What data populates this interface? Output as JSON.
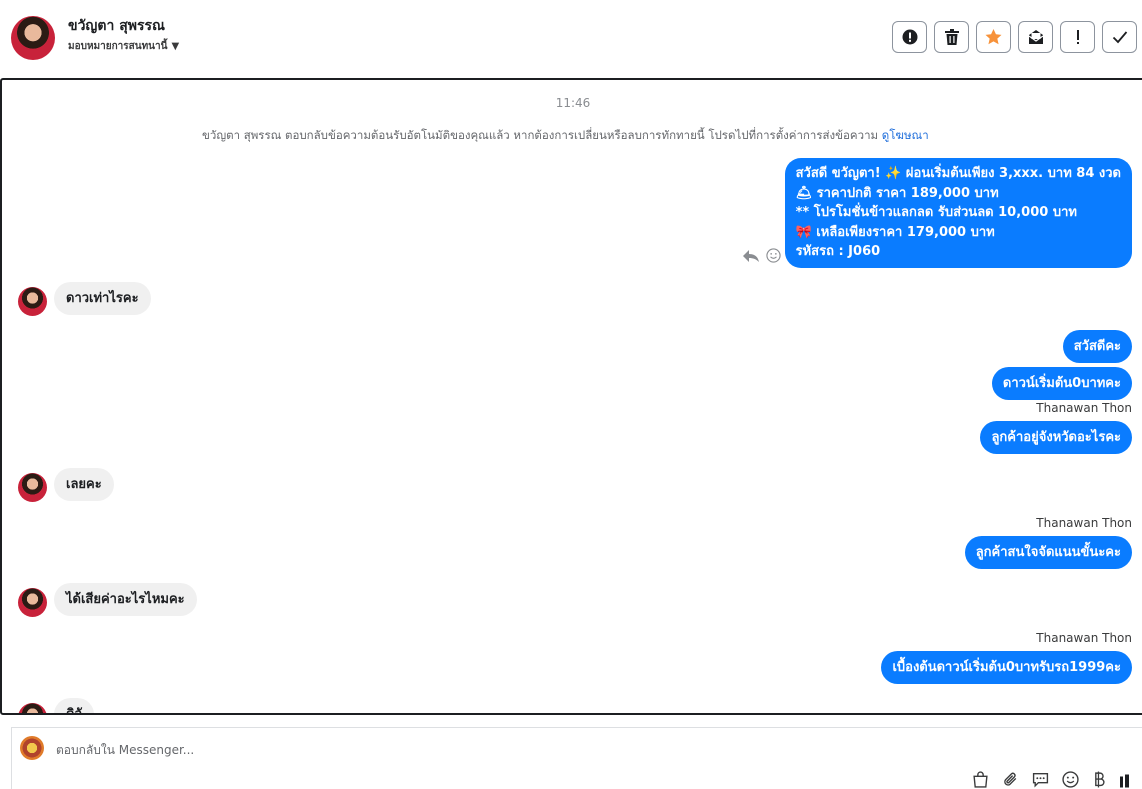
{
  "header": {
    "contact_name": "ขวัญตา สุพรรณ",
    "assign_label": "มอบหมายการสนทนานี้"
  },
  "toolbar": {
    "buttons": [
      {
        "icon": "alert-circle-icon"
      },
      {
        "icon": "trash-icon"
      },
      {
        "icon": "star-icon",
        "color": "#f7923a"
      },
      {
        "icon": "mark-unread-icon"
      },
      {
        "icon": "exclamation-icon"
      },
      {
        "icon": "check-icon"
      }
    ]
  },
  "chat": {
    "timestamp": "11:46",
    "system_note": "ขวัญตา สุพรรณ ตอบกลับข้อความต้อนรับอัตโนมัติของคุณแล้ว หากต้องการเปลี่ยนหรือลบการทักทายนี้ โปรดไปที่การตั้งค่าการส่งข้อความ ",
    "system_link": "ดูโฆษณา",
    "promo_lines": [
      "สวัสดี ขวัญตา! ✨  ผ่อนเริ่มต้นเพียง 3,xxx. บาท 84 งวด",
      "🛎 ราคาปกติ ราคา 189,000 บาท",
      "** โปรโมชั่นข้าวแลกลด รับส่วนลด 10,000 บาท",
      "🎀  เหลือเพียงราคา 179,000 บาท",
      " รหัสรถ : J060"
    ],
    "incoming_1": "ดาวเท่าไรคะ",
    "outgoing_1": "สวัสดีคะ",
    "outgoing_2": "ดาวน์เริ่มต้น0บาทคะ",
    "sender_1": "Thanawan Thon",
    "outgoing_3": "ลูกค้าอยู่จังหวัดอะไรคะ",
    "incoming_2": "เลยคะ",
    "sender_2": "Thanawan Thon",
    "outgoing_4": "ลูกค้าสนใจจัดแนนขั้นะคะ",
    "incoming_3": "ได้เสียค่าอะไรไหมคะ",
    "sender_3": "Thanawan Thon",
    "outgoing_5": "เบื้องต้นดาวน์เริ่มต้น0บาทรับรถ1999คะ",
    "incoming_4_partial": "ดิจั"
  },
  "composer": {
    "placeholder": "ตอบกลับใน Messenger..."
  },
  "colors": {
    "outgoing_bubble": "#0a7cff",
    "incoming_bubble": "#f0f0f0",
    "link": "#216fdb",
    "star": "#f7923a"
  }
}
